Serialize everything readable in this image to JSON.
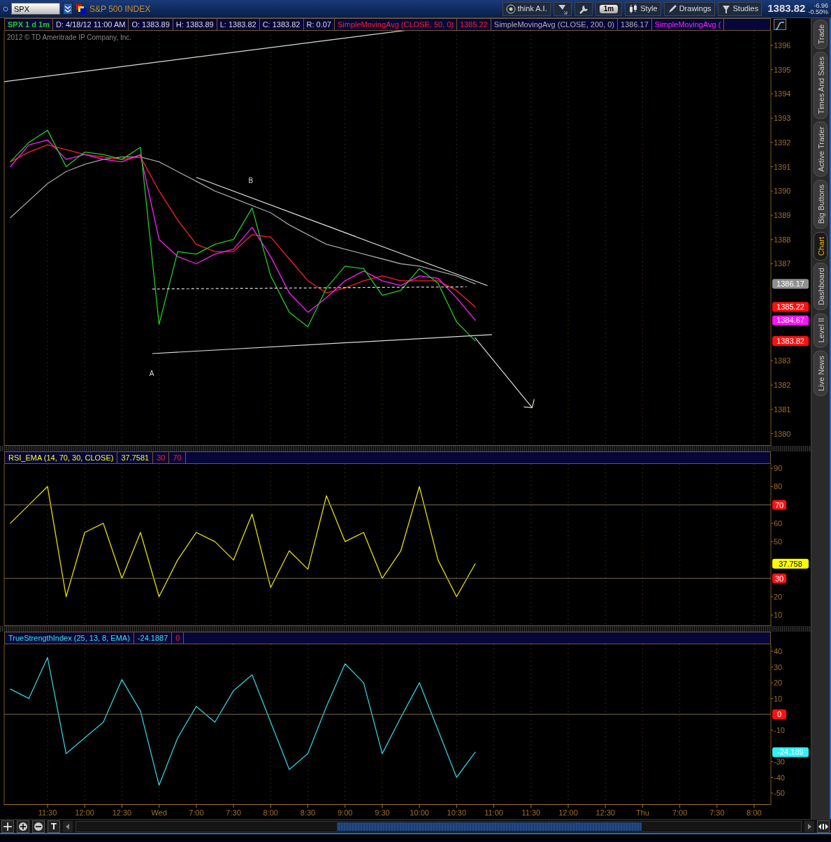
{
  "window": {
    "symbol": "SPX",
    "description": "S&P 500 INDEX"
  },
  "toolbar": [
    {
      "kind": "ai",
      "label": "think A.I."
    },
    {
      "kind": "drawtool"
    },
    {
      "kind": "wrench"
    },
    {
      "kind": "period",
      "label": "1m"
    },
    {
      "kind": "style",
      "label": "Style"
    },
    {
      "kind": "drawings",
      "label": "Drawings"
    },
    {
      "kind": "studies",
      "label": "Studies"
    }
  ],
  "quote": {
    "last": "1383.82",
    "change": "-6.96",
    "percent": "-0.50%"
  },
  "info_bar": [
    {
      "text": "SPX 1 d 1m",
      "kind": "title"
    },
    {
      "text": "D: 4/18/12 11:00 AM",
      "kind": "value"
    },
    {
      "text": "O: 1383.89",
      "kind": "value"
    },
    {
      "text": "H: 1383.89",
      "kind": "value"
    },
    {
      "text": "L: 1383.82",
      "kind": "value"
    },
    {
      "text": "C: 1383.82",
      "kind": "value"
    },
    {
      "text": "R: 0.07",
      "kind": "value"
    },
    {
      "text": "SimpleMovingAvg (CLOSE, 50, 0)",
      "kind": "sma50"
    },
    {
      "text": "1385.22",
      "kind": "sma50"
    },
    {
      "text": "SimpleMovingAvg (CLOSE, 200, 0)",
      "kind": "sma200"
    },
    {
      "text": "1386.17",
      "kind": "sma200"
    },
    {
      "text": "SimpleMovingAvg (",
      "kind": "sma_fast"
    }
  ],
  "copyright": "2012 © TD Ameritrade IP Company, Inc.",
  "main_chart": {
    "chart_data": {
      "type": "line",
      "ylim": [
        1379.5,
        1396.6
      ],
      "grid": true,
      "yticks": [
        1380,
        1381,
        1382,
        1383,
        1387,
        1388,
        1389,
        1390,
        1391,
        1392,
        1393,
        1394,
        1395,
        1396
      ],
      "series": [
        {
          "color": "#a0a0a0",
          "values": [
            1388.9,
            1389.6,
            1390.3,
            1390.8,
            1391.1,
            1391.3,
            1391.4,
            1391.4,
            1391.2,
            1390.8,
            1390.4,
            1390.0,
            1389.7,
            1389.4,
            1389.1,
            1388.6,
            1388.2,
            1387.8,
            1387.6,
            1387.4,
            1387.2,
            1387.0,
            1386.9,
            1386.7,
            1386.5,
            1386.17
          ]
        },
        {
          "color": "#ff2020",
          "values": [
            1391.2,
            1391.6,
            1391.9,
            1391.7,
            1391.5,
            1391.4,
            1391.3,
            1391.4,
            1390.0,
            1388.8,
            1387.8,
            1387.5,
            1387.5,
            1388.2,
            1388.1,
            1387.2,
            1386.3,
            1385.8,
            1386.0,
            1386.3,
            1386.5,
            1386.3,
            1386.3,
            1386.3,
            1385.9,
            1385.22
          ]
        },
        {
          "color": "#ff20ff",
          "values": [
            1391.0,
            1391.9,
            1392.1,
            1391.3,
            1391.5,
            1391.3,
            1391.2,
            1391.5,
            1388.0,
            1387.3,
            1387.0,
            1387.4,
            1387.6,
            1388.5,
            1387.3,
            1385.8,
            1385.0,
            1385.6,
            1386.3,
            1386.7,
            1386.3,
            1386.1,
            1386.5,
            1386.4,
            1385.6,
            1384.67
          ]
        },
        {
          "color": "#22cc22",
          "values": [
            1391.2,
            1392.0,
            1392.5,
            1391.0,
            1391.6,
            1391.5,
            1391.3,
            1391.8,
            1384.5,
            1387.5,
            1387.4,
            1387.8,
            1388.0,
            1389.3,
            1386.5,
            1385.0,
            1384.4,
            1386.0,
            1386.9,
            1386.8,
            1385.7,
            1385.9,
            1386.8,
            1386.2,
            1384.6,
            1383.82
          ]
        }
      ]
    },
    "point_labels": [
      "A",
      "B"
    ],
    "value_tags": [
      {
        "text": "1386.17",
        "color": "#909090"
      },
      {
        "text": "1385.22",
        "color": "#ff1010"
      },
      {
        "text": "1384.67",
        "color": "#ff10ff"
      },
      {
        "text": "1383.82",
        "color": "#ff1010"
      }
    ]
  },
  "rsi_panel": {
    "legend": [
      {
        "text": "RSI_EMA (14, 70, 30, CLOSE)",
        "kind": "study"
      },
      {
        "text": "37.7581",
        "kind": "study"
      },
      {
        "text": "30",
        "kind": "level"
      },
      {
        "text": "70",
        "kind": "level"
      }
    ],
    "level_lines": [
      "70",
      "30"
    ],
    "chart_data": {
      "type": "line",
      "ylim": [
        4.0,
        92.3
      ],
      "grid": true,
      "yticks": [
        10,
        20,
        50,
        60,
        80,
        90
      ],
      "series": [
        {
          "color": "#e8e000",
          "values": [
            60,
            70,
            80,
            20,
            55,
            60,
            30,
            55,
            20,
            40,
            55,
            50,
            40,
            65,
            25,
            45,
            35,
            75,
            50,
            55,
            30,
            45,
            80,
            40,
            20,
            38
          ]
        }
      ]
    },
    "value_tags": [
      {
        "text": "37.758",
        "color": "#ffff00"
      }
    ]
  },
  "tsi_panel": {
    "legend": [
      {
        "text": "TrueStrengthIndex (25, 13, 8, EMA)",
        "kind": "study"
      },
      {
        "text": "-24.1887",
        "kind": "study"
      },
      {
        "text": "0",
        "kind": "level"
      }
    ],
    "level_lines": [
      "0"
    ],
    "chart_data": {
      "type": "line",
      "ylim": [
        -57.5,
        44.4
      ],
      "grid": true,
      "yticks": [
        -50,
        -40,
        -30,
        -10,
        10,
        20,
        30,
        40
      ],
      "categories": [
        null,
        null,
        "11:30",
        null,
        "12:00",
        null,
        "12:30",
        null,
        "Wed",
        null,
        "7:00",
        null,
        "7:30",
        null,
        "8:00",
        null,
        "8:30",
        null,
        "9:00",
        null,
        "9:30",
        null,
        "10:00",
        null,
        "10:30",
        null,
        "11:00",
        null,
        "11:30",
        null,
        "12:00",
        null,
        "12:30",
        null,
        "Thu",
        null,
        "7:00",
        null,
        "7:30",
        null,
        "8:00"
      ],
      "series": [
        {
          "color": "#30d0e0",
          "values": [
            16,
            10,
            36,
            -25,
            -15,
            -5,
            22,
            2,
            -45,
            -15,
            5,
            -5,
            15,
            25,
            -5,
            -35,
            -25,
            5,
            32,
            20,
            -25,
            -2,
            20,
            -10,
            -40,
            -24,
            null,
            null,
            null,
            null,
            null,
            null,
            null,
            null,
            null,
            null,
            null,
            null,
            null,
            null,
            null
          ]
        }
      ]
    },
    "value_tags": [
      {
        "text": "-24.189",
        "color": "#30f0f8"
      }
    ]
  },
  "side_tabs": [
    {
      "label": "Trade",
      "selected": false
    },
    {
      "label": "Times And Sales",
      "selected": false
    },
    {
      "label": "Active Trader",
      "selected": false
    },
    {
      "label": "Big Buttons",
      "selected": false
    },
    {
      "label": "Chart",
      "selected": true
    },
    {
      "label": "Dashboard",
      "selected": false
    },
    {
      "label": "Level II",
      "selected": false
    },
    {
      "label": "Live News",
      "selected": false
    }
  ],
  "bottom_tools": [
    {
      "kind": "crosshair"
    },
    {
      "kind": "zoom_in"
    },
    {
      "kind": "zoom_out"
    },
    {
      "kind": "text",
      "label": "T"
    }
  ]
}
